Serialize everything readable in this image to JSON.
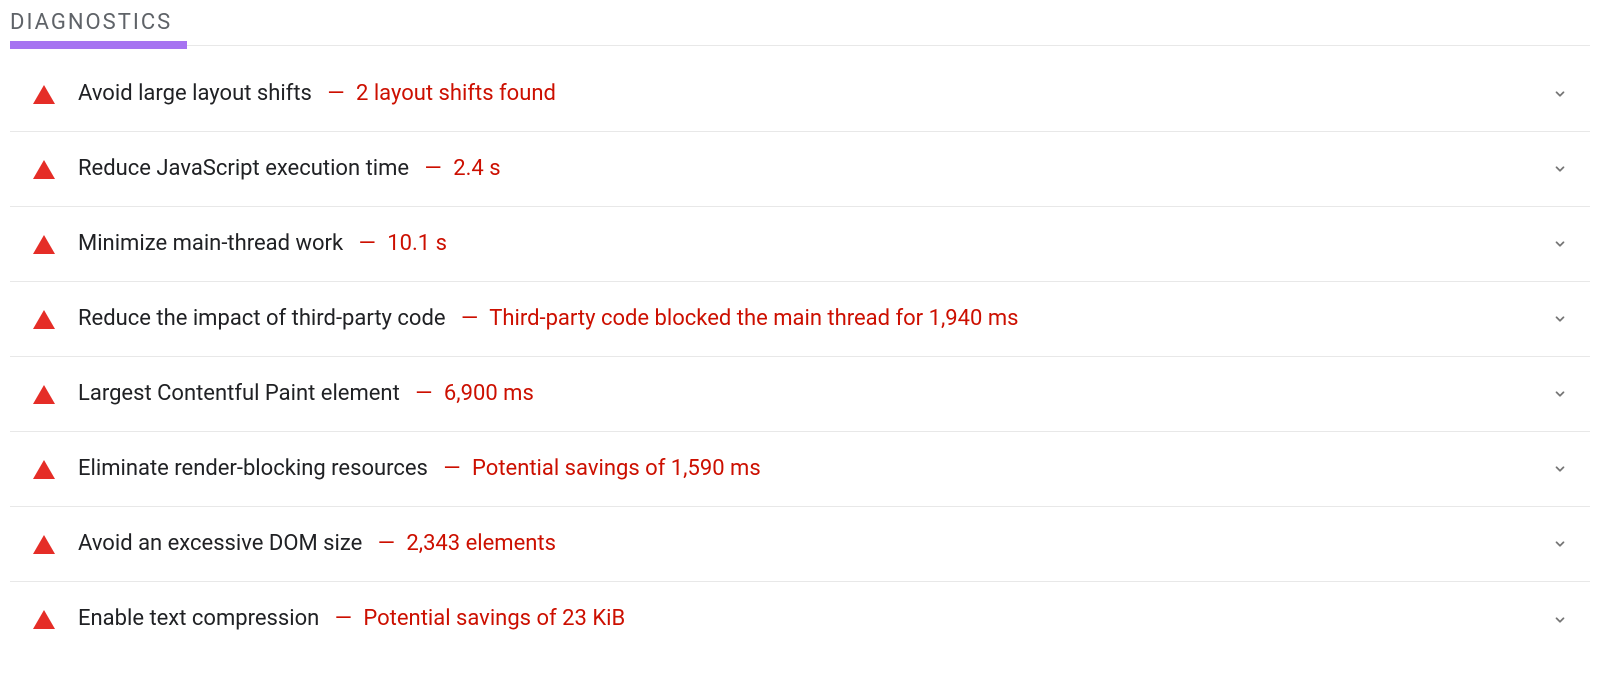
{
  "section": {
    "title": "DIAGNOSTICS"
  },
  "diagnostics": [
    {
      "title": "Avoid large layout shifts",
      "value": "2 layout shifts found"
    },
    {
      "title": "Reduce JavaScript execution time",
      "value": "2.4 s"
    },
    {
      "title": "Minimize main-thread work",
      "value": "10.1 s"
    },
    {
      "title": "Reduce the impact of third-party code",
      "value": "Third-party code blocked the main thread for 1,940 ms"
    },
    {
      "title": "Largest Contentful Paint element",
      "value": "6,900 ms"
    },
    {
      "title": "Eliminate render-blocking resources",
      "value": "Potential savings of 1,590 ms"
    },
    {
      "title": "Avoid an excessive DOM size",
      "value": "2,343 elements"
    },
    {
      "title": "Enable text compression",
      "value": "Potential savings of 23 KiB"
    }
  ],
  "dash": "—"
}
